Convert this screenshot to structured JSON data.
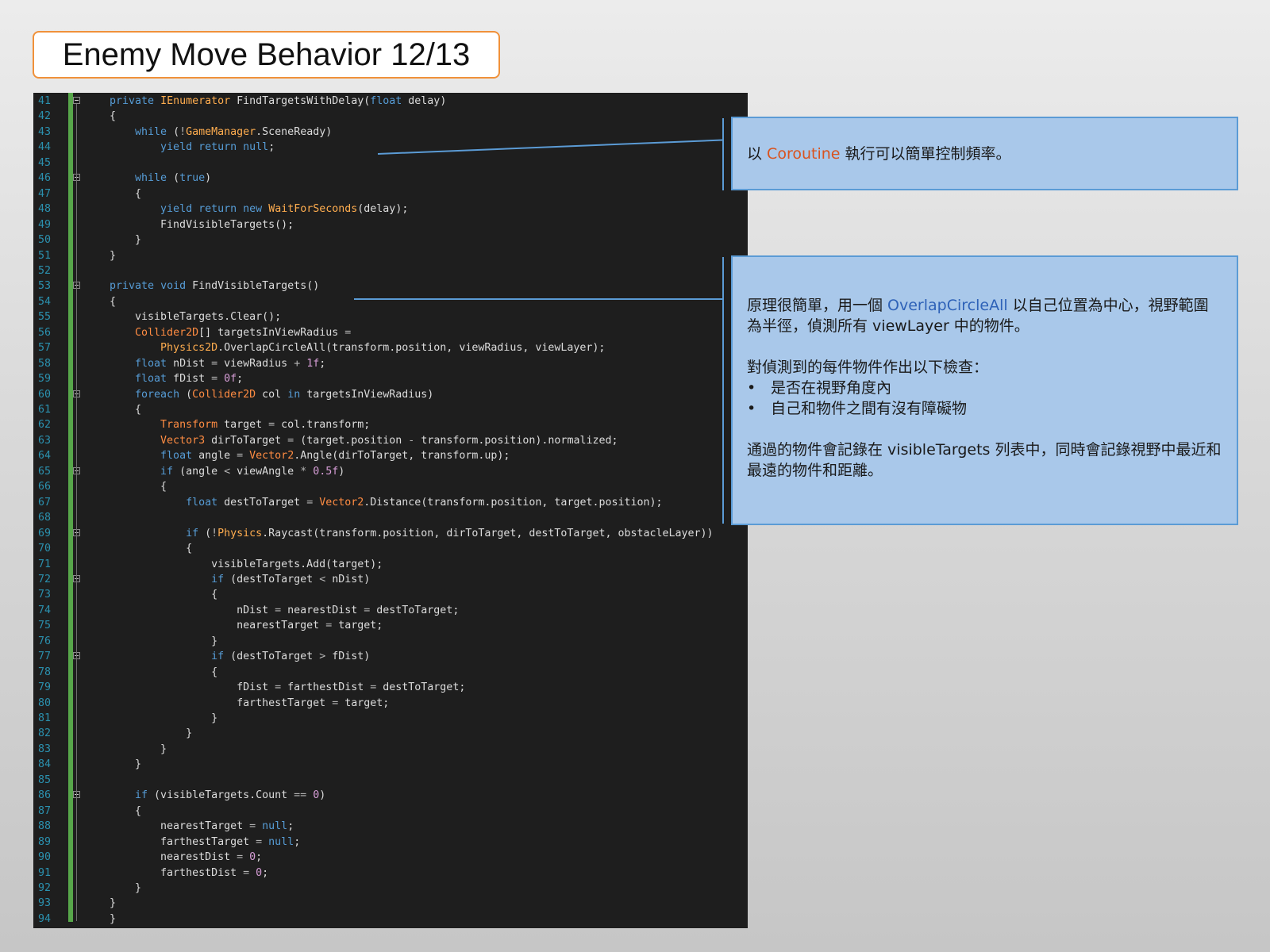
{
  "slide": {
    "title": "Enemy Move Behavior 12/13"
  },
  "code": {
    "lines": [
      {
        "n": "41",
        "html": "<span class='kw'>private</span> <span class='ty'>IEnumerator</span> FindTargetsWithDelay(<span class='kw'>float</span> delay)",
        "fold": true
      },
      {
        "n": "42",
        "html": "{"
      },
      {
        "n": "43",
        "html": "    <span class='kw'>while</span> (<span class='op'>!</span><span class='ty'>GameManager</span>.SceneReady)"
      },
      {
        "n": "44",
        "html": "        <span class='kw'>yield</span> <span class='kw'>return</span> <span class='kw'>null</span>;"
      },
      {
        "n": "45",
        "html": ""
      },
      {
        "n": "46",
        "html": "    <span class='kw'>while</span> (<span class='kw'>true</span>)",
        "fold": true
      },
      {
        "n": "47",
        "html": "    {"
      },
      {
        "n": "48",
        "html": "        <span class='kw'>yield</span> <span class='kw'>return</span> <span class='kw'>new</span> <span class='ty'>WaitForSeconds</span>(delay);"
      },
      {
        "n": "49",
        "html": "        FindVisibleTargets();"
      },
      {
        "n": "50",
        "html": "    }"
      },
      {
        "n": "51",
        "html": "}"
      },
      {
        "n": "52",
        "html": ""
      },
      {
        "n": "53",
        "html": "<span class='kw'>private</span> <span class='kw'>void</span> FindVisibleTargets()",
        "fold": true
      },
      {
        "n": "54",
        "html": "{"
      },
      {
        "n": "55",
        "html": "    visibleTargets.Clear();"
      },
      {
        "n": "56",
        "html": "    <span class='ty2'>Collider2D</span>[] targetsInViewRadius <span class='op'>=</span>"
      },
      {
        "n": "57",
        "html": "        <span class='ty'>Physics2D</span>.OverlapCircleAll(transform.position, viewRadius, viewLayer);"
      },
      {
        "n": "58",
        "html": "    <span class='kw'>float</span> nDist <span class='op'>=</span> viewRadius <span class='op'>+</span> <span class='pink'>1f</span>;"
      },
      {
        "n": "59",
        "html": "    <span class='kw'>float</span> fDist <span class='op'>=</span> <span class='pink'>0f</span>;"
      },
      {
        "n": "60",
        "html": "    <span class='kw'>foreach</span> (<span class='ty2'>Collider2D</span> col <span class='kw'>in</span> targetsInViewRadius)",
        "fold": true
      },
      {
        "n": "61",
        "html": "    {"
      },
      {
        "n": "62",
        "html": "        <span class='ty2'>Transform</span> target <span class='op'>=</span> col.transform;"
      },
      {
        "n": "63",
        "html": "        <span class='ty2'>Vector3</span> dirToTarget <span class='op'>=</span> (target.position <span class='op'>-</span> transform.position).normalized;"
      },
      {
        "n": "64",
        "html": "        <span class='kw'>float</span> angle <span class='op'>=</span> <span class='ty2'>Vector2</span>.Angle(dirToTarget, transform.up);"
      },
      {
        "n": "65",
        "html": "        <span class='kw'>if</span> (angle <span class='op'>&lt;</span> viewAngle <span class='op'>*</span> <span class='pink'>0.5f</span>)",
        "fold": true
      },
      {
        "n": "66",
        "html": "        {"
      },
      {
        "n": "67",
        "html": "            <span class='kw'>float</span> destToTarget <span class='op'>=</span> <span class='ty2'>Vector2</span>.Distance(transform.position, target.position);"
      },
      {
        "n": "68",
        "html": ""
      },
      {
        "n": "69",
        "html": "            <span class='kw'>if</span> (<span class='op'>!</span><span class='ty'>Physics</span>.Raycast(transform.position, dirToTarget, destToTarget, obstacleLayer))",
        "fold": true
      },
      {
        "n": "70",
        "html": "            {"
      },
      {
        "n": "71",
        "html": "                visibleTargets.Add(target);"
      },
      {
        "n": "72",
        "html": "                <span class='kw'>if</span> (destToTarget <span class='op'>&lt;</span> nDist)",
        "fold": true
      },
      {
        "n": "73",
        "html": "                {"
      },
      {
        "n": "74",
        "html": "                    nDist <span class='op'>=</span> nearestDist <span class='op'>=</span> destToTarget;"
      },
      {
        "n": "75",
        "html": "                    nearestTarget <span class='op'>=</span> target;"
      },
      {
        "n": "76",
        "html": "                }"
      },
      {
        "n": "77",
        "html": "                <span class='kw'>if</span> (destToTarget <span class='op'>&gt;</span> fDist)",
        "fold": true
      },
      {
        "n": "78",
        "html": "                {"
      },
      {
        "n": "79",
        "html": "                    fDist <span class='op'>=</span> farthestDist <span class='op'>=</span> destToTarget;"
      },
      {
        "n": "80",
        "html": "                    farthestTarget <span class='op'>=</span> target;"
      },
      {
        "n": "81",
        "html": "                }"
      },
      {
        "n": "82",
        "html": "            }"
      },
      {
        "n": "83",
        "html": "        }"
      },
      {
        "n": "84",
        "html": "    }"
      },
      {
        "n": "85",
        "html": ""
      },
      {
        "n": "86",
        "html": "    <span class='kw'>if</span> (visibleTargets.Count <span class='op'>==</span> <span class='pink'>0</span>)",
        "fold": true
      },
      {
        "n": "87",
        "html": "    {"
      },
      {
        "n": "88",
        "html": "        nearestTarget <span class='op'>=</span> <span class='kw'>null</span>;"
      },
      {
        "n": "89",
        "html": "        farthestTarget <span class='op'>=</span> <span class='kw'>null</span>;"
      },
      {
        "n": "90",
        "html": "        nearestDist <span class='op'>=</span> <span class='pink'>0</span>;"
      },
      {
        "n": "91",
        "html": "        farthestDist <span class='op'>=</span> <span class='pink'>0</span>;"
      },
      {
        "n": "92",
        "html": "    }"
      },
      {
        "n": "93",
        "html": "}"
      },
      {
        "n": "94",
        "html": "}"
      }
    ]
  },
  "notes": {
    "coroutine": {
      "pre": "以 ",
      "accent": "Coroutine",
      "post": " 執行可以簡單控制頻率。"
    },
    "overlap": {
      "p1_pre": "原理很簡單，用一個 ",
      "p1_accent": "OverlapCircleAll",
      "p1_post": " 以自己位置為中心，視野範圍為半徑，偵測所有 viewLayer 中的物件。",
      "p2": "對偵測到的每件物件作出以下檢查：",
      "bullets": [
        "是否在視野角度內",
        "自己和物件之間有沒有障礙物"
      ],
      "p3": "通過的物件會記錄在 visibleTargets 列表中，同時會記錄視野中最近和最遠的物件和距離。"
    }
  },
  "colors": {
    "title_border": "#f0913a",
    "note_fill": "#a9c8ea",
    "note_border": "#5b9bd5",
    "accent_orange": "#d9531e",
    "accent_blue": "#2e62b8"
  }
}
